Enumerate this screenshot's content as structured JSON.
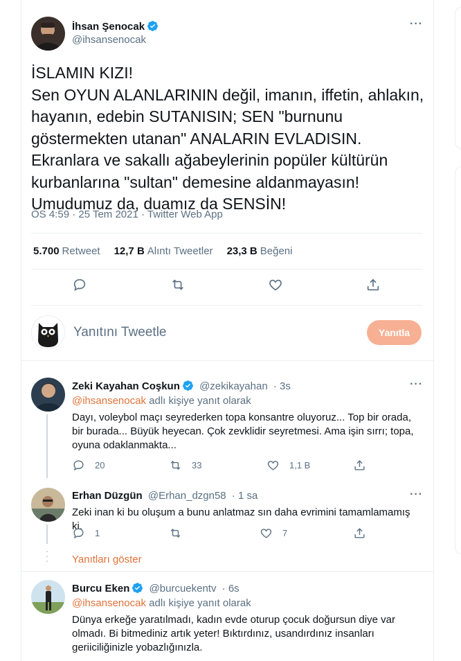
{
  "main_tweet": {
    "author_name": "İhsan Şenocak",
    "author_handle": "@ihsansenocak",
    "text": "İSLAMIN KIZI!\nSen OYUN ALANLARININ değil, imanın, iffetin, ahlakın, hayanın, edebin SUTANISIN; SEN \"burnunu göstermekten utanan\" ANALARIN EVLADISIN. Ekranlara ve sakallı ağabeylerinin popüler kültürün kurbanlarına \"sultan\" demesine aldanmayasın! Umudumuz da, duamız da SENSİN!",
    "time": "ÖS 4:59 · 25 Tem 2021 · Twitter Web App",
    "retweets_count": "5.700",
    "retweets_label": "Retweet",
    "quotes_count": "12,7 B",
    "quotes_label": "Alıntı Tweetler",
    "likes_count": "23,3 B",
    "likes_label": "Beğeni"
  },
  "compose": {
    "placeholder": "Yanıtını Tweetle",
    "button_label": "Yanıtla"
  },
  "replies": [
    {
      "author_name": "Zeki Kayahan Coşkun",
      "author_handle": "@zekikayahan",
      "time": "· 3s",
      "reply_to_mention": "@ihsansenocak",
      "reply_to_suffix": " adlı kişiye yanıt olarak",
      "text": "Dayı, voleybol maçı seyrederken topa konsantre oluyoruz... Top bir orada, bir burada... Büyük heyecan. Çok zevklidir seyretmesi. Ama işin sırrı; topa, oyuna odaklanmakta...",
      "reply_count": "20",
      "retweet_count": "33",
      "like_count": "1,1 B"
    },
    {
      "author_name": "Erhan Düzgün",
      "author_handle": "@Erhan_dzgn58",
      "time": "· 1 sa",
      "text": "Zeki inan ki bu oluşum a bunu anlatmaz sın daha evrimini tamamlamamış ki.",
      "reply_count": "1",
      "retweet_count": "",
      "like_count": "7"
    },
    {
      "author_name": "Burcu Eken",
      "author_handle": "@burcuekentv",
      "time": "· 6s",
      "reply_to_mention": "@ihsansenocak",
      "reply_to_suffix": " adlı kişiye yanıt olarak",
      "text": "Dünya erkeğe yaratılmadı, kadın evde oturup çocuk doğursun diye var olmadı. Bi bitmediniz artık yeter! Bıktırdınız, usandırdınız insanları geriiciliğinizle yobazlığınızla."
    }
  ],
  "show_replies_label": "Yanıtları göster",
  "colors": {
    "accent": "#e0733a",
    "verified": "#1da1f2",
    "muted": "#5b7083",
    "reply_button": "#f7b094"
  }
}
